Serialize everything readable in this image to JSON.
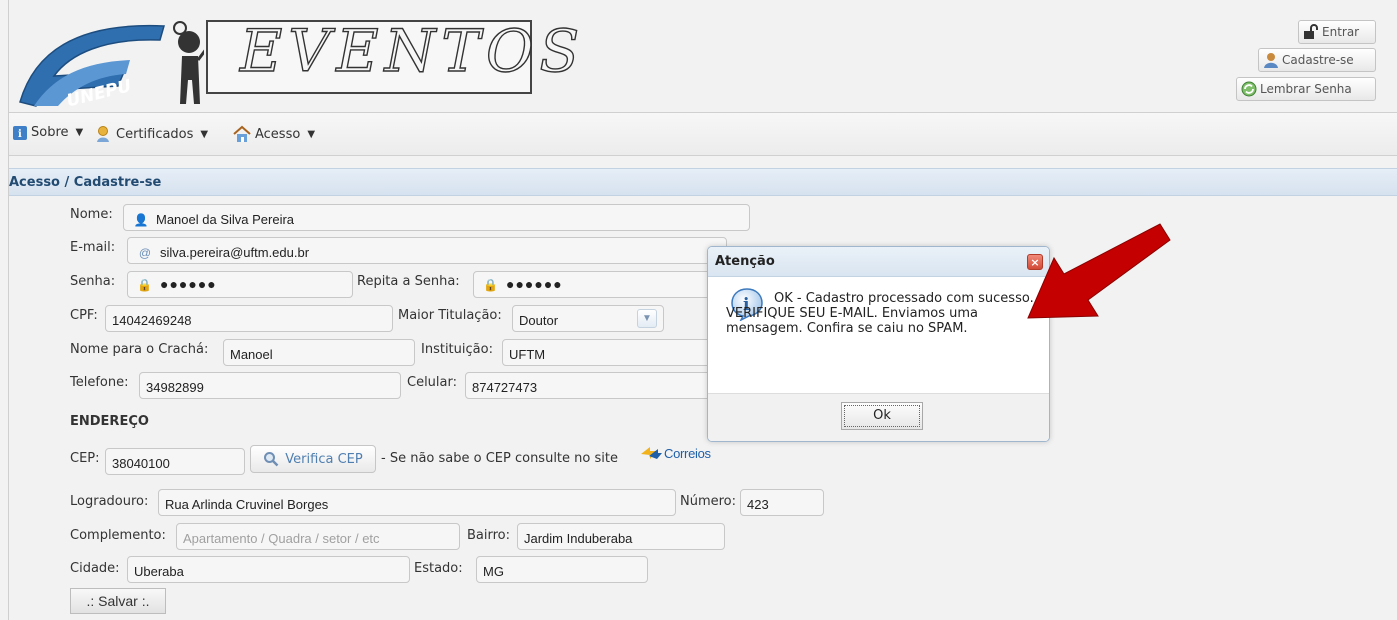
{
  "header": {
    "logo_text": "UNEPU",
    "banner_text": "EVENTOS",
    "buttons": [
      {
        "label": "Entrar",
        "icon": "lock-open-icon"
      },
      {
        "label": "Cadastre-se",
        "icon": "user-icon"
      },
      {
        "label": "Lembrar Senha",
        "icon": "refresh-icon"
      }
    ]
  },
  "menu": {
    "items": [
      {
        "label": "Sobre",
        "icon": "info-icon"
      },
      {
        "label": "Certificados",
        "icon": "certificate-icon"
      },
      {
        "label": "Acesso",
        "icon": "home-icon"
      }
    ]
  },
  "panel": {
    "title": "Acesso / Cadastre-se"
  },
  "form": {
    "nome": {
      "label": "Nome:",
      "value": "Manoel da Silva Pereira"
    },
    "email": {
      "label": "E-mail:",
      "value": "silva.pereira@uftm.edu.br"
    },
    "senha": {
      "label": "Senha:",
      "value": "●●●●●●"
    },
    "repita_senha": {
      "label": "Repita a Senha:",
      "value": "●●●●●●"
    },
    "cpf": {
      "label": "CPF:",
      "value": "14042469248"
    },
    "titulacao": {
      "label": "Maior Titulação:",
      "value": "Doutor"
    },
    "cracha": {
      "label": "Nome para o Crachá:",
      "value": "Manoel"
    },
    "instituicao": {
      "label": "Instituição:",
      "value": "UFTM"
    },
    "telefone": {
      "label": "Telefone:",
      "value": "34982899"
    },
    "celular": {
      "label": "Celular:",
      "value": "874727473"
    },
    "endereco_heading": "ENDEREÇO",
    "cep": {
      "label": "CEP:",
      "value": "38040100"
    },
    "verifica_cep": "Verifica CEP",
    "cep_hint": "- Se não sabe o CEP consulte no site",
    "correios": "Correios",
    "logradouro": {
      "label": "Logradouro:",
      "value": "Rua Arlinda Cruvinel Borges"
    },
    "numero": {
      "label": "Número:",
      "value": "423"
    },
    "complemento": {
      "label": "Complemento:",
      "placeholder": "Apartamento / Quadra / setor / etc"
    },
    "bairro": {
      "label": "Bairro:",
      "value": "Jardim Induberaba"
    },
    "cidade": {
      "label": "Cidade:",
      "value": "Uberaba"
    },
    "estado": {
      "label": "Estado:",
      "value": "MG"
    },
    "save_label": ".: Salvar :."
  },
  "dialog": {
    "title": "Atenção",
    "message": "OK - Cadastro processado com sucesso. - VERIFIQUE SEU E-MAIL. Enviamos uma mensagem. Confira se caiu no SPAM.",
    "ok_label": "Ok"
  },
  "colors": {
    "panel_title": "#234b72",
    "arrow": "#c40000",
    "logo_blue": "#2f6fb0"
  }
}
